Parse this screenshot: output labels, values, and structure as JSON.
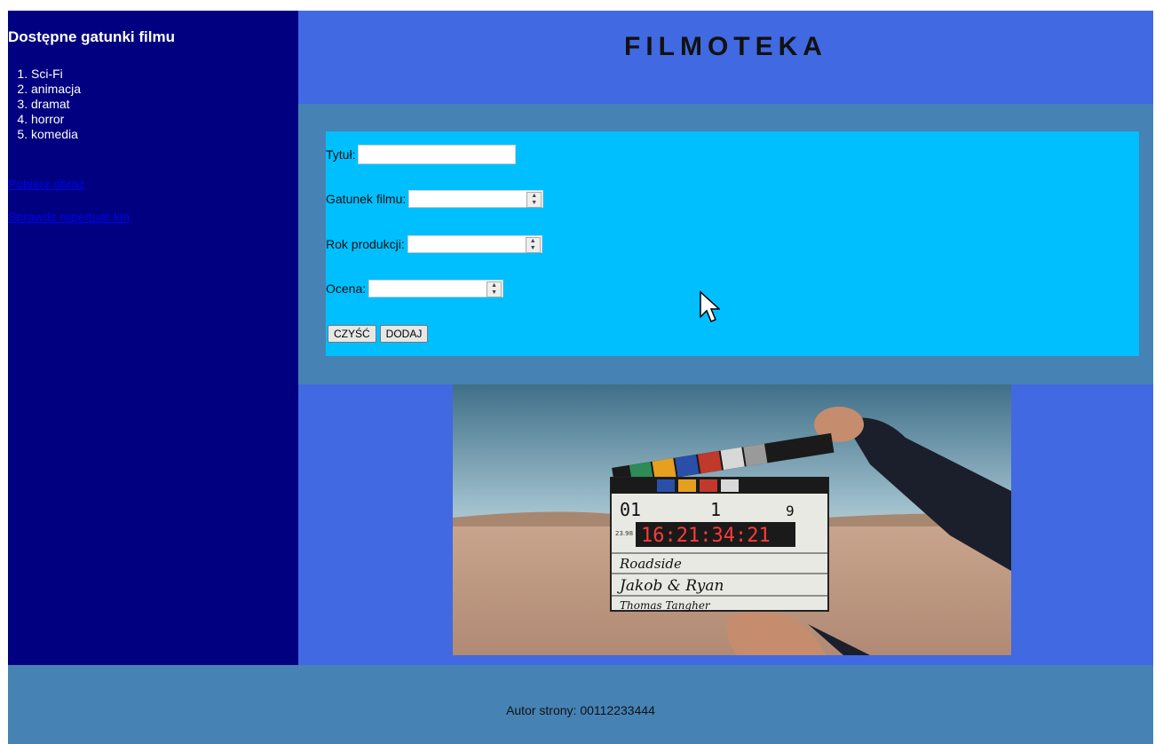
{
  "sidebar": {
    "heading": "Dostępne gatunki filmu",
    "genres": [
      "Sci-Fi",
      "animacja",
      "dramat",
      "horror",
      "komedia"
    ],
    "link_download": "Pobierz obraz",
    "link_repertoire": "Sprawdź repertuar kin"
  },
  "header": {
    "title": "FILMOTEKA"
  },
  "form": {
    "title_label": "Tytuł:",
    "genre_label": "Gatunek filmu:",
    "year_label": "Rok produkcji:",
    "rating_label": "Ocena:",
    "clear_button": "CZYŚĆ",
    "add_button": "DODAJ"
  },
  "image": {
    "clapper": {
      "roll": "01",
      "scene": "1",
      "take": "9",
      "fps": "23.98",
      "timecode": "16:21:34:21",
      "production": "Roadside",
      "director": "Jakob & Ryan",
      "camera": "Thomas Tangher"
    }
  },
  "footer": {
    "author": "Autor strony: 00112233444"
  },
  "colors": {
    "sidebar": "#000080",
    "header": "#4169e1",
    "form_band": "#4682b4",
    "form_box": "#00bfff",
    "footer": "#4682b4"
  }
}
